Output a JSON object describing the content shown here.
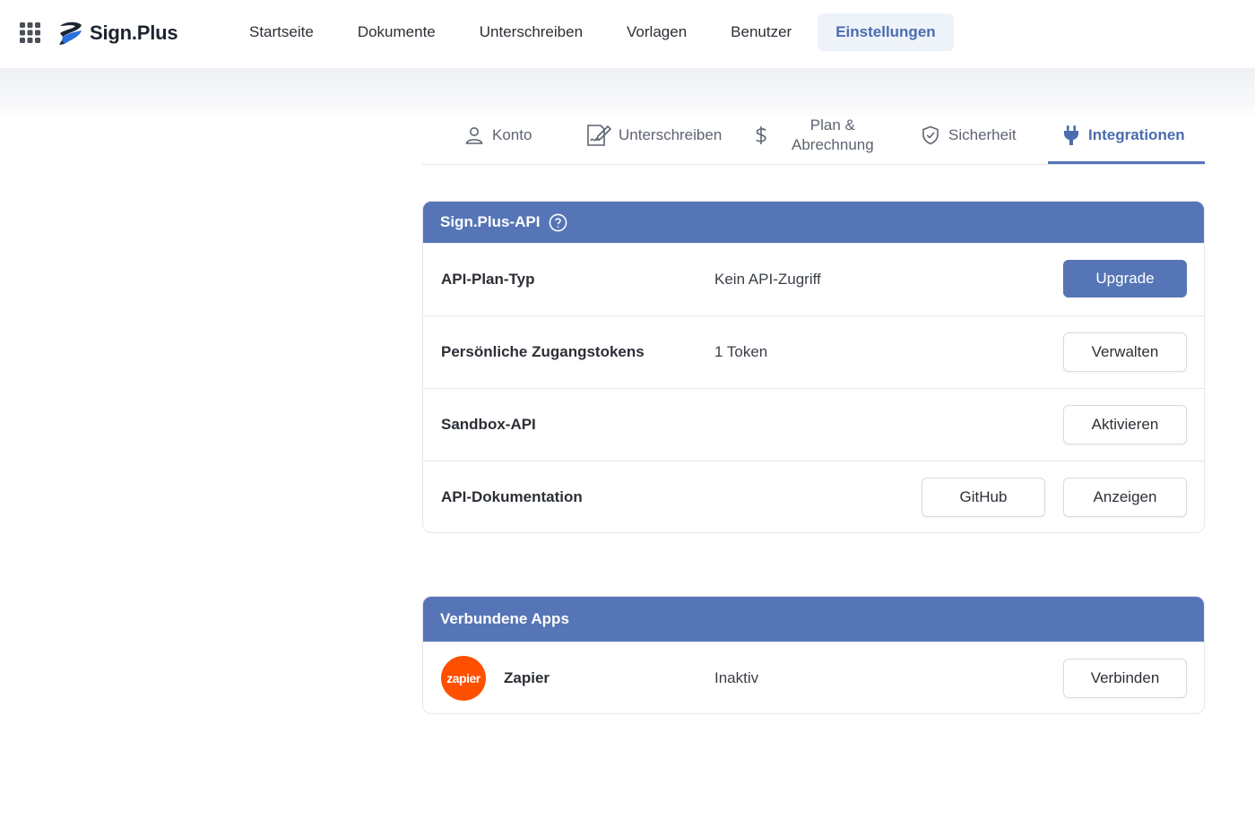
{
  "app": {
    "brand": "Sign.Plus"
  },
  "topnav": {
    "items": [
      {
        "label": "Startseite"
      },
      {
        "label": "Dokumente"
      },
      {
        "label": "Unterschreiben"
      },
      {
        "label": "Vorlagen"
      },
      {
        "label": "Benutzer"
      },
      {
        "label": "Einstellungen",
        "active": true
      }
    ]
  },
  "settings_tabs": [
    {
      "label": "Konto",
      "icon": "user-icon"
    },
    {
      "label": "Unterschreiben",
      "icon": "sign-document-icon"
    },
    {
      "label_line1": "Plan &",
      "label_line2": "Abrechnung",
      "icon": "dollar-icon"
    },
    {
      "label": "Sicherheit",
      "icon": "shield-icon"
    },
    {
      "label": "Integrationen",
      "icon": "plug-icon",
      "active": true
    }
  ],
  "api_card": {
    "title": "Sign.Plus-API",
    "rows": [
      {
        "label": "API-Plan-Typ",
        "value": "Kein API-Zugriff",
        "button": "Upgrade"
      },
      {
        "label": "Persönliche Zugangstokens",
        "value": "1 Token",
        "button": "Verwalten"
      },
      {
        "label": "Sandbox-API",
        "value": "",
        "button": "Aktivieren"
      },
      {
        "label": "API-Dokumentation",
        "value": "",
        "button_secondary": "GitHub",
        "button": "Anzeigen"
      }
    ]
  },
  "apps_card": {
    "title": "Verbundene Apps",
    "apps": [
      {
        "logo_text": "zapier",
        "name": "Zapier",
        "status": "Inaktiv",
        "button": "Verbinden"
      }
    ]
  },
  "colors": {
    "accent": "#5675b6",
    "active_nav_bg": "#eef2f9",
    "zapier": "#ff4f00"
  }
}
